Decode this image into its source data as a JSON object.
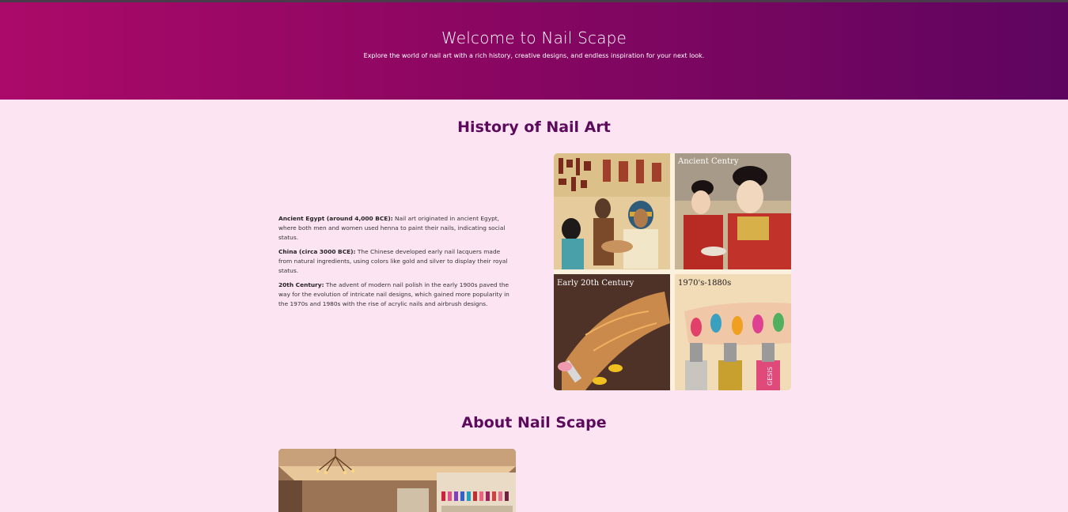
{
  "header": {
    "title": "Welcome to Nail Scape",
    "tagline": "Explore the world of nail art with a rich history, creative designs, and endless inspiration for your next look."
  },
  "history": {
    "heading": "History of Nail Art",
    "entries": [
      {
        "label": "Ancient Egypt (around 4,000 BCE):",
        "text": " Nail art originated in ancient Egypt, where both men and women used henna to paint their nails, indicating social status."
      },
      {
        "label": "China (circa 3000 BCE):",
        "text": " The Chinese developed early nail lacquers made from natural ingredients, using colors like gold and silver to display their royal status."
      },
      {
        "label": "20th Century:",
        "text": " The advent of modern nail polish in the early 1900s paved the way for the evolution of intricate nail designs, which gained more popularity in the 1970s and 1980s with the rise of acrylic nails and airbrush designs."
      }
    ],
    "image_captions": {
      "ancient": "Ancient Centry",
      "early20": "Early 20th Century",
      "seventies": "1970's-1880s",
      "bottle_text": "GESIS"
    }
  },
  "about": {
    "heading": "About Nail Scape"
  },
  "colors": {
    "header_gradient_start": "#ab0a69",
    "header_gradient_end": "#5e0560",
    "page_background": "#fde4f2",
    "heading_color": "#5c0a5c"
  }
}
